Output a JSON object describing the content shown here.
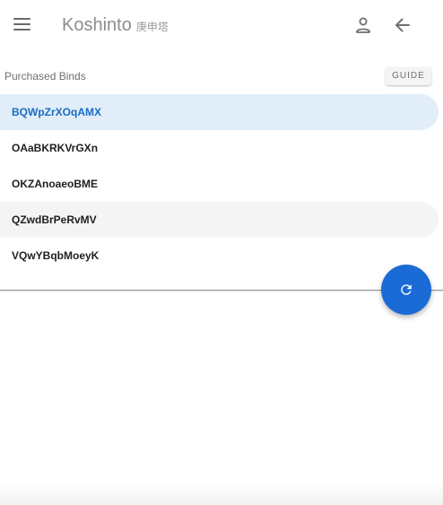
{
  "app_bar": {
    "title": "Koshinto",
    "subtitle": "庚申塔",
    "menu_icon": "menu-icon",
    "account_icon": "account-icon",
    "back_icon": "arrow-back-icon"
  },
  "panel": {
    "section_label": "Purchased Binds",
    "guide_label": "GUIDE",
    "items": [
      {
        "label": "BQWpZrXOqAMX",
        "state": "selected"
      },
      {
        "label": "OAaBKRKVrGXn",
        "state": "normal"
      },
      {
        "label": "OKZAnoaeoBME",
        "state": "normal"
      },
      {
        "label": "QZwdBrPeRvMV",
        "state": "hovered"
      },
      {
        "label": "VQwYBqbMoeyK",
        "state": "normal"
      }
    ]
  },
  "fab": {
    "icon": "refresh-icon"
  },
  "colors": {
    "accent": "#1a6bd6",
    "selected_bg": "#e1edf9",
    "selected_text": "#1a6bc2",
    "hover_bg": "#f4f4f4"
  }
}
